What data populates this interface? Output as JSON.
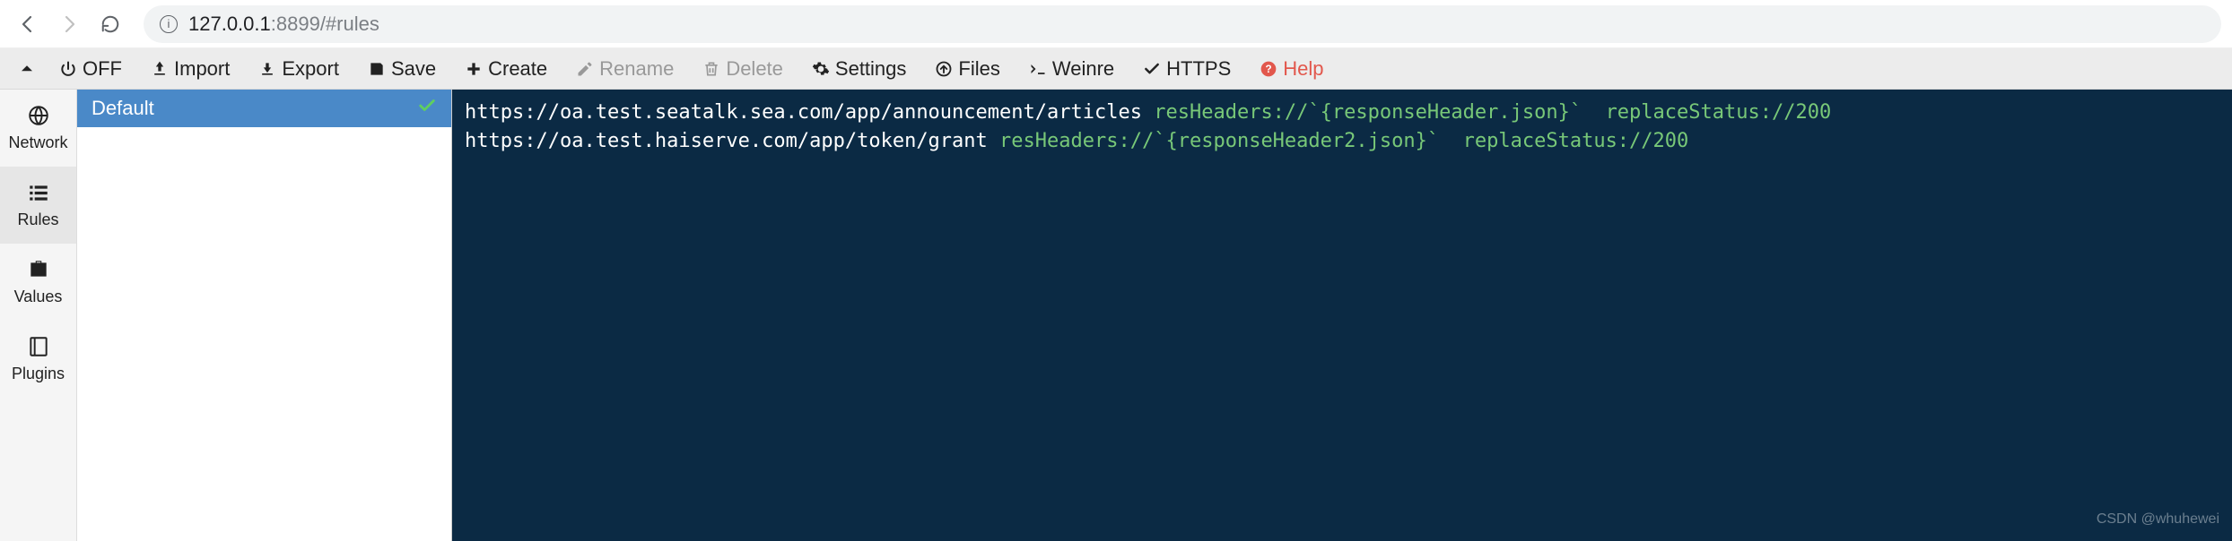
{
  "browser": {
    "url_host": "127.0.0.1",
    "url_port": ":8899",
    "url_hash": "/#rules"
  },
  "toolbar": {
    "off": "OFF",
    "import": "Import",
    "export": "Export",
    "save": "Save",
    "create": "Create",
    "rename": "Rename",
    "delete": "Delete",
    "settings": "Settings",
    "files": "Files",
    "weinre": "Weinre",
    "https": "HTTPS",
    "help": "Help"
  },
  "sidebar": {
    "network": "Network",
    "rules": "Rules",
    "values": "Values",
    "plugins": "Plugins"
  },
  "rules_list": {
    "items": [
      {
        "label": "Default"
      }
    ]
  },
  "editor": {
    "lines": [
      {
        "url": "https://oa.test.seatalk.sea.com/app/announcement/articles",
        "k1": "resHeaders://`{responseHeader.json}`",
        "k2": "replaceStatus://200"
      },
      {
        "url": "https://oa.test.haiserve.com/app/token/grant",
        "k1": "resHeaders://`{responseHeader2.json}`",
        "k2": "replaceStatus://200"
      }
    ]
  },
  "watermark": "CSDN @whuhewei"
}
